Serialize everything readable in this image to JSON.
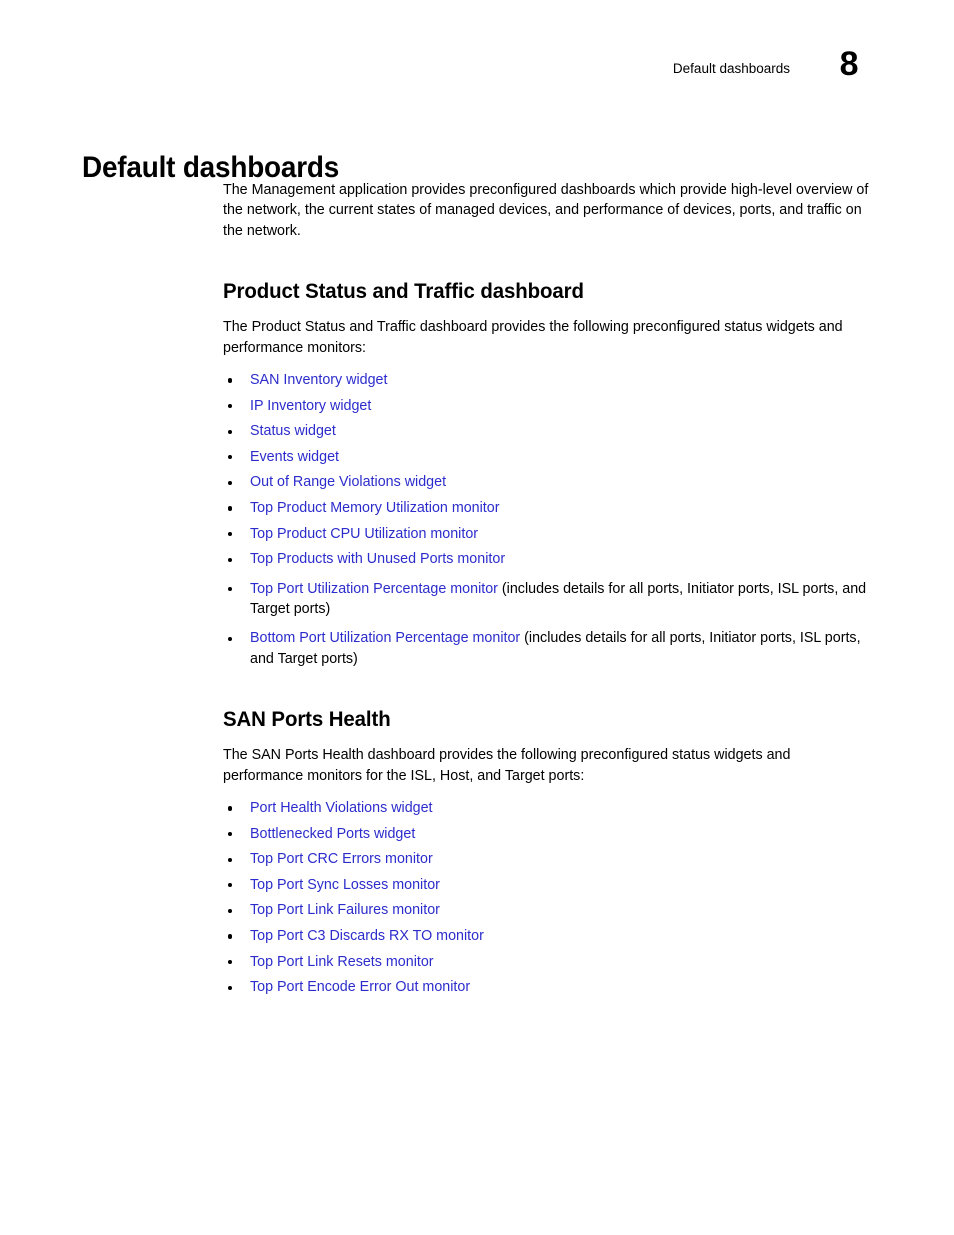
{
  "header": {
    "running_title": "Default dashboards",
    "chapter_number": "8"
  },
  "chapter_title": "Default dashboards",
  "intro_paragraph": "The Management application provides preconfigured dashboards which provide high-level overview of the network, the current states of managed devices, and performance of devices, ports, and traffic on the network.",
  "sections": [
    {
      "heading": "Product Status and Traffic dashboard",
      "paragraph": "The Product Status and Traffic dashboard provides the following preconfigured status widgets and performance monitors:",
      "bullets": [
        {
          "link": "SAN Inventory widget",
          "rest": ""
        },
        {
          "link": "IP Inventory widget",
          "rest": ""
        },
        {
          "link": "Status widget",
          "rest": ""
        },
        {
          "link": "Events widget",
          "rest": ""
        },
        {
          "link": "Out of Range Violations widget",
          "rest": ""
        },
        {
          "link": "Top Product Memory Utilization monitor",
          "rest": ""
        },
        {
          "link": "Top Product CPU Utilization monitor",
          "rest": ""
        },
        {
          "link": "Top Products with Unused Ports monitor",
          "rest": ""
        },
        {
          "link": "Top Port Utilization Percentage monitor",
          "rest": " (includes details for all ports, Initiator ports, ISL ports, and Target ports)"
        },
        {
          "link": "Bottom Port Utilization Percentage monitor",
          "rest": " (includes details for all ports, Initiator ports, ISL ports, and Target ports)"
        }
      ]
    },
    {
      "heading": "SAN Ports Health",
      "paragraph": "The SAN Ports Health dashboard provides the following preconfigured status widgets and performance monitors for the ISL, Host, and Target ports:",
      "bullets": [
        {
          "link": "Port Health Violations widget",
          "rest": ""
        },
        {
          "link": "Bottlenecked Ports widget",
          "rest": ""
        },
        {
          "link": "Top Port CRC Errors monitor",
          "rest": ""
        },
        {
          "link": "Top Port Sync Losses monitor",
          "rest": ""
        },
        {
          "link": "Top Port Link Failures monitor",
          "rest": ""
        },
        {
          "link": "Top Port C3 Discards RX TO monitor",
          "rest": ""
        },
        {
          "link": "Top Port Link Resets monitor",
          "rest": ""
        },
        {
          "link": "Top Port Encode Error Out monitor",
          "rest": ""
        }
      ]
    }
  ],
  "colors": {
    "link": "#2c2ccc",
    "text": "#000000",
    "background": "#ffffff"
  }
}
